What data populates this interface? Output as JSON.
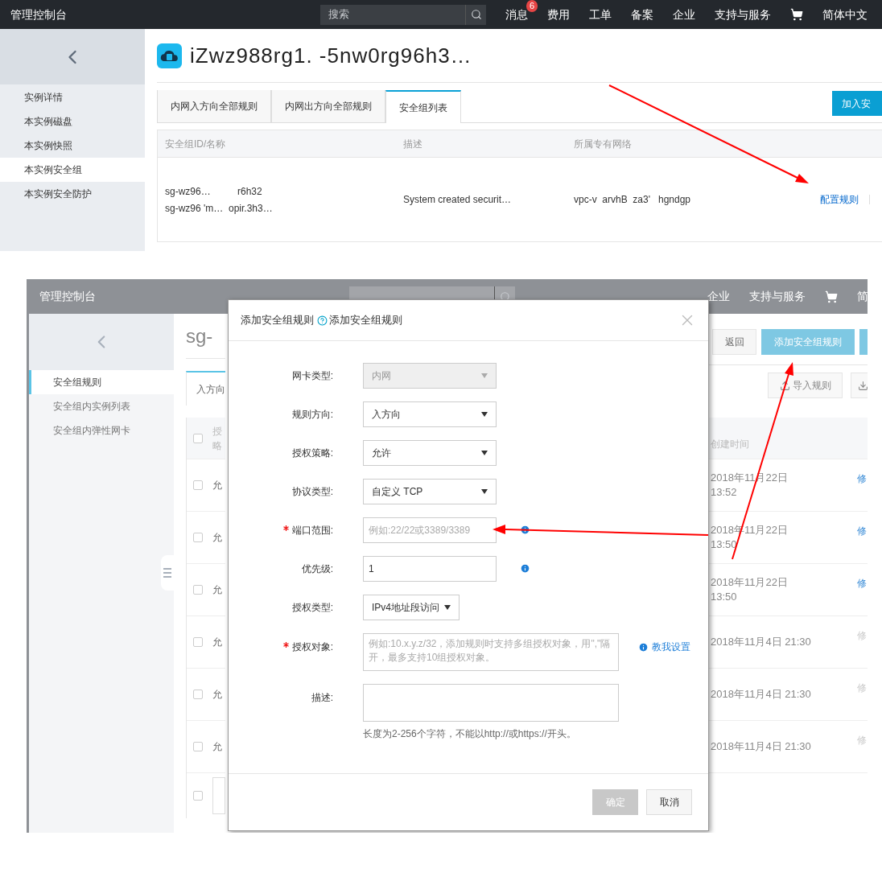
{
  "top": {
    "navbar": {
      "brand": "管理控制台",
      "search_placeholder": "搜索",
      "items": [
        {
          "label": "消息",
          "badge": "6"
        },
        {
          "label": "费用"
        },
        {
          "label": "工单"
        },
        {
          "label": "备案"
        },
        {
          "label": "企业"
        },
        {
          "label": "支持与服务"
        }
      ],
      "language": "简体中文"
    },
    "sidebar": [
      {
        "label": "实例详情",
        "selected": false
      },
      {
        "label": "本实例磁盘",
        "selected": false
      },
      {
        "label": "本实例快照",
        "selected": false
      },
      {
        "label": "本实例安全组",
        "selected": true
      },
      {
        "label": "本实例安全防护",
        "selected": false
      }
    ],
    "title": "iZwz988rg1. -5nw0rg96h3…",
    "tabs": [
      {
        "label": "内网入方向全部规则",
        "selected": false
      },
      {
        "label": "内网出方向全部规则",
        "selected": false
      },
      {
        "label": "安全组列表",
        "selected": true
      }
    ],
    "add_button": "加入安",
    "table": {
      "columns": [
        "安全组ID/名称",
        "描述",
        "所属专有网络"
      ],
      "rows": [
        {
          "ids": [
            "sg-wz96…          r6h32",
            "sg-wz96 'm…  opir.3h3…"
          ],
          "description": "System created securit…",
          "vpc": "vpc-v  arvhB  za3'   hgndgp",
          "action": "配置规则"
        }
      ]
    }
  },
  "bottom": {
    "navbar": {
      "brand": "管理控制台",
      "items": [
        {
          "label": "企业"
        },
        {
          "label": "支持与服务"
        }
      ],
      "language": "简"
    },
    "sidebar": [
      {
        "label": "安全组规则",
        "selected": true
      },
      {
        "label": "安全组内实例列表",
        "selected": false
      },
      {
        "label": "安全组内弹性网卡",
        "selected": false
      }
    ],
    "title": "sg-",
    "tab": "入方向",
    "header": {
      "column_1": "授略",
      "checked": false
    },
    "buttons": [
      {
        "label": "返回",
        "kind": "plain"
      },
      {
        "label": "添加安全组规则",
        "kind": "primary"
      }
    ],
    "import_button": "导入规则",
    "date_column": "创建时间",
    "rows": [
      {
        "checked": false,
        "column_1": "允",
        "date": "2018年11月22日 13:52",
        "action": "修",
        "disabled": false
      },
      {
        "checked": false,
        "column_1": "允",
        "date": "2018年11月22日 13:50",
        "action": "修",
        "disabled": false
      },
      {
        "checked": false,
        "column_1": "允",
        "date": "2018年11月22日 13:50",
        "action": "修",
        "disabled": false
      },
      {
        "checked": false,
        "column_1": "允",
        "date": "2018年11月4日 21:30",
        "action": "修",
        "disabled": true
      },
      {
        "checked": false,
        "column_1": "允",
        "date": "2018年11月4日 21:30",
        "action": "修",
        "disabled": true
      },
      {
        "checked": false,
        "column_1": "允",
        "date": "2018年11月4日 21:30",
        "action": "修",
        "disabled": true
      }
    ],
    "footer": {
      "checked": false
    },
    "dialog": {
      "title": "添加安全组规则",
      "help": "添加安全组规则",
      "fields": [
        {
          "kind": "select",
          "label": "网卡类型:",
          "value": "内网",
          "disabled": true,
          "required": false,
          "info": false
        },
        {
          "kind": "select",
          "label": "规则方向:",
          "value": "入方向",
          "disabled": false,
          "required": false,
          "info": false
        },
        {
          "kind": "select",
          "label": "授权策略:",
          "value": "允许",
          "disabled": false,
          "required": false,
          "info": false
        },
        {
          "kind": "select",
          "label": "协议类型:",
          "value": "自定义 TCP",
          "disabled": false,
          "required": false,
          "info": false
        },
        {
          "kind": "input",
          "label": "端口范围:",
          "placeholder": "例如:22/22或3389/3389",
          "required": true,
          "info": true
        },
        {
          "kind": "input",
          "label": "优先级:",
          "value": "1",
          "required": false,
          "info": true
        },
        {
          "kind": "select",
          "label": "授权类型:",
          "value": "IPv4地址段访问",
          "disabled": false,
          "compact": true,
          "required": false,
          "info": false
        },
        {
          "kind": "textarea",
          "label": "授权对象:",
          "placeholder": "例如:10.x.y.z/32，添加规则时支持多组授权对象，用\",\"隔开，最多支持10组授权对象。",
          "required": true,
          "info": false,
          "link": "教我设置"
        },
        {
          "kind": "textarea",
          "label": "描述:",
          "required": false,
          "info": false,
          "hint": "长度为2-256个字符，不能以http://或https://开头。"
        }
      ],
      "buttons": [
        {
          "label": "确定",
          "disabled": true
        },
        {
          "label": "取消",
          "disabled": false
        }
      ]
    }
  }
}
